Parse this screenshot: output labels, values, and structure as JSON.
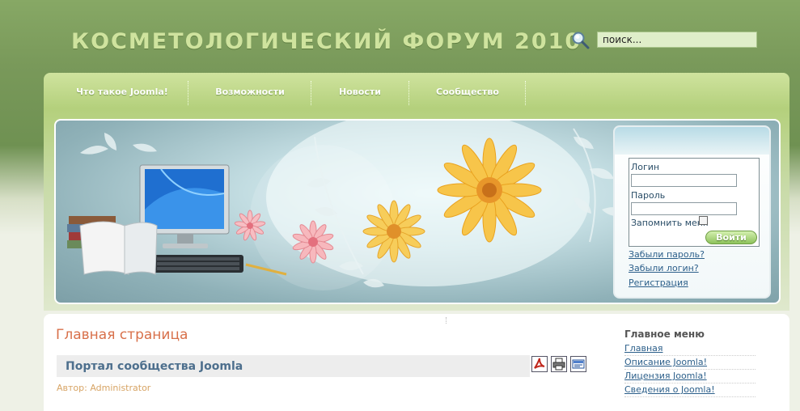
{
  "header": {
    "site_title": "КОСМЕТОЛОГИЧЕСКИЙ ФОРУМ 2010",
    "search_value": "поиск..."
  },
  "nav": {
    "items": [
      {
        "label": "Что такое Joomla!"
      },
      {
        "label": "Возможности"
      },
      {
        "label": "Новости"
      },
      {
        "label": "Сообщество"
      }
    ]
  },
  "login": {
    "username_label": "Логин",
    "password_label": "Пароль",
    "remember_label": "Запомнить меня",
    "submit_label": "Войти",
    "links": [
      {
        "label": "Забыли пароль?"
      },
      {
        "label": "Забыли логин?"
      },
      {
        "label": "Регистрация"
      }
    ]
  },
  "main": {
    "page_title": "Главная страница",
    "article_title": "Портал сообщества Joomla",
    "author": "Автор: Administrator"
  },
  "sidebar": {
    "title": "Главное меню",
    "links": [
      {
        "label": "Главная"
      },
      {
        "label": "Описание Joomla!"
      },
      {
        "label": "Лицензия Joomla!"
      },
      {
        "label": "Сведения о Joomla!"
      }
    ]
  },
  "colors": {
    "header_green": "#79995a",
    "nav_green": "#b4d07c",
    "title_orange": "#d8704a",
    "link_blue": "#2c5f8a"
  }
}
